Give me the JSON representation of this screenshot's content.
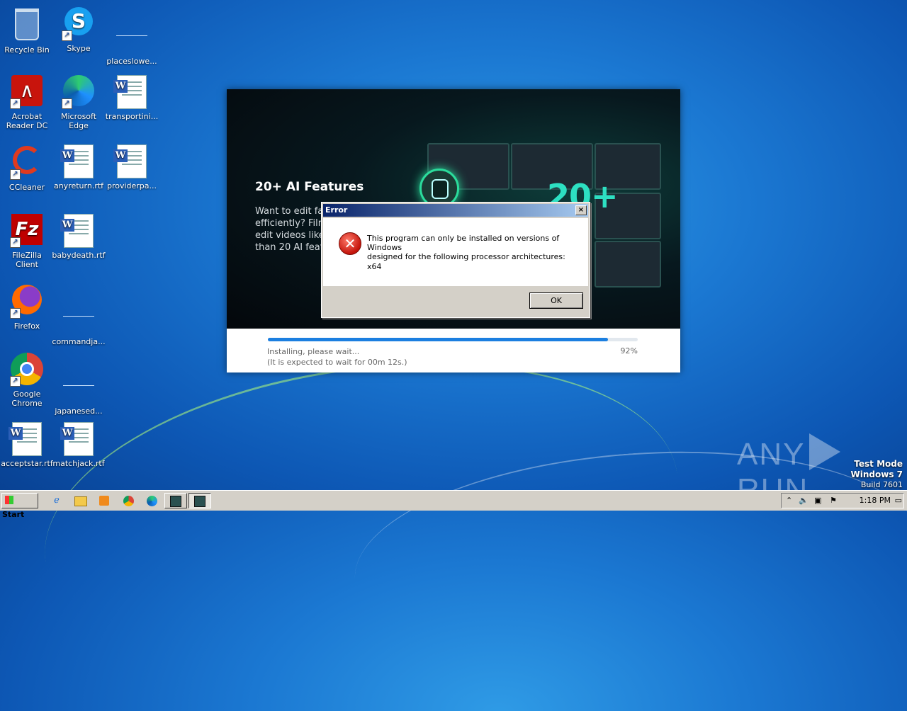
{
  "desktop": {
    "icons": [
      {
        "label": "Recycle Bin"
      },
      {
        "label": "Skype"
      },
      {
        "label": "placeslowe..."
      },
      {
        "label": "Acrobat Reader DC"
      },
      {
        "label": "Microsoft Edge"
      },
      {
        "label": "transportini..."
      },
      {
        "label": "CCleaner"
      },
      {
        "label": "anyreturn.rtf"
      },
      {
        "label": "providerpa..."
      },
      {
        "label": "FileZilla Client"
      },
      {
        "label": "babydeath.rtf"
      },
      {
        "label": "Firefox"
      },
      {
        "label": "commandja..."
      },
      {
        "label": "Google Chrome"
      },
      {
        "label": "japanesed..."
      },
      {
        "label": "acceptstar.rtf"
      },
      {
        "label": "matchjack.rtf"
      }
    ]
  },
  "installer": {
    "banner_title": "20+ AI Features",
    "banner_text": "Want to edit fas efficiently? Film edit videos like than 20 AI featu",
    "banner_big": "20+",
    "progress": 0.92,
    "status_line1": "Installing, please wait...",
    "status_line2": "(It is expected to wait for 00m 12s.)",
    "percent": "92%"
  },
  "dialog": {
    "title": "Error",
    "close": "×",
    "message_line1": "This program can only be installed on versions of Windows",
    "message_line2": "designed for the following processor architectures:",
    "arch": "x64",
    "ok_label": "OK"
  },
  "watermark": {
    "left": "ANY",
    "right": "RUN"
  },
  "windows_version": {
    "line1": "Test Mode",
    "line2": "Windows 7",
    "line3": "Build 7601"
  },
  "taskbar": {
    "start_label": "Start",
    "clock": "1:18 PM"
  },
  "colors": {
    "accent": "#1c7fe0",
    "titlebar": "#0a246a",
    "error_red": "#c4140b"
  }
}
